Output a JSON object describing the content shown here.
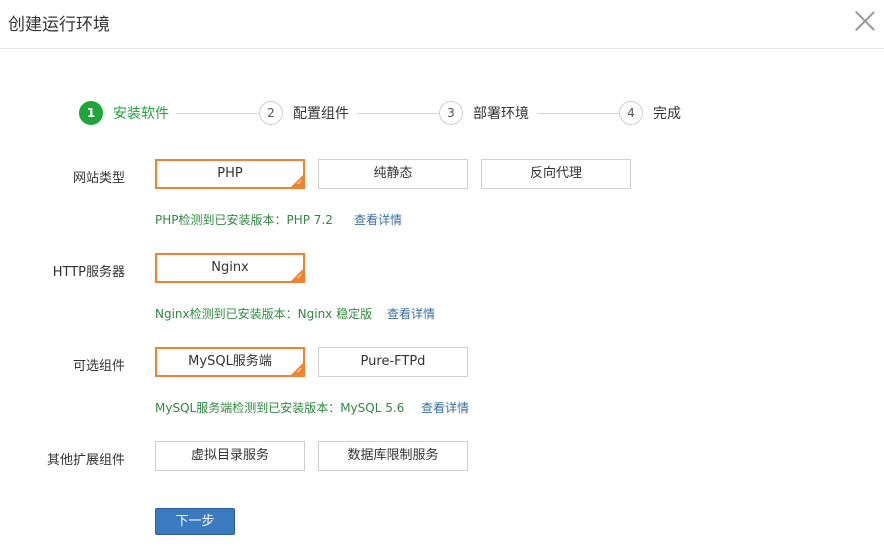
{
  "dialog": {
    "title": "创建运行环境"
  },
  "steps": [
    {
      "num": "1",
      "label": "安装软件",
      "active": true
    },
    {
      "num": "2",
      "label": "配置组件",
      "active": false
    },
    {
      "num": "3",
      "label": "部署环境",
      "active": false
    },
    {
      "num": "4",
      "label": "完成",
      "active": false
    }
  ],
  "website_type": {
    "label": "网站类型",
    "options": [
      "PHP",
      "纯静态",
      "反向代理"
    ],
    "selected": "PHP",
    "info": "PHP检测到已安装版本：PHP 7.2",
    "link": "查看详情"
  },
  "http_server": {
    "label": "HTTP服务器",
    "options": [
      "Nginx"
    ],
    "selected": "Nginx",
    "info": "Nginx检测到已安装版本：Nginx 稳定版",
    "link": "查看详情"
  },
  "optional_components": {
    "label": "可选组件",
    "options": [
      "MySQL服务端",
      "Pure-FTPd"
    ],
    "selected": "MySQL服务端",
    "info": "MySQL服务端检测到已安装版本：MySQL 5.6",
    "link": "查看详情"
  },
  "other_extensions": {
    "label": "其他扩展组件",
    "options": [
      "虚拟目录服务",
      "数据库限制服务"
    ]
  },
  "next_button": "下一步",
  "colors": {
    "accent_green": "#20a53a",
    "selected_orange": "#f08332",
    "primary_blue": "#3b79c0",
    "link_blue": "#3a6ea5"
  }
}
